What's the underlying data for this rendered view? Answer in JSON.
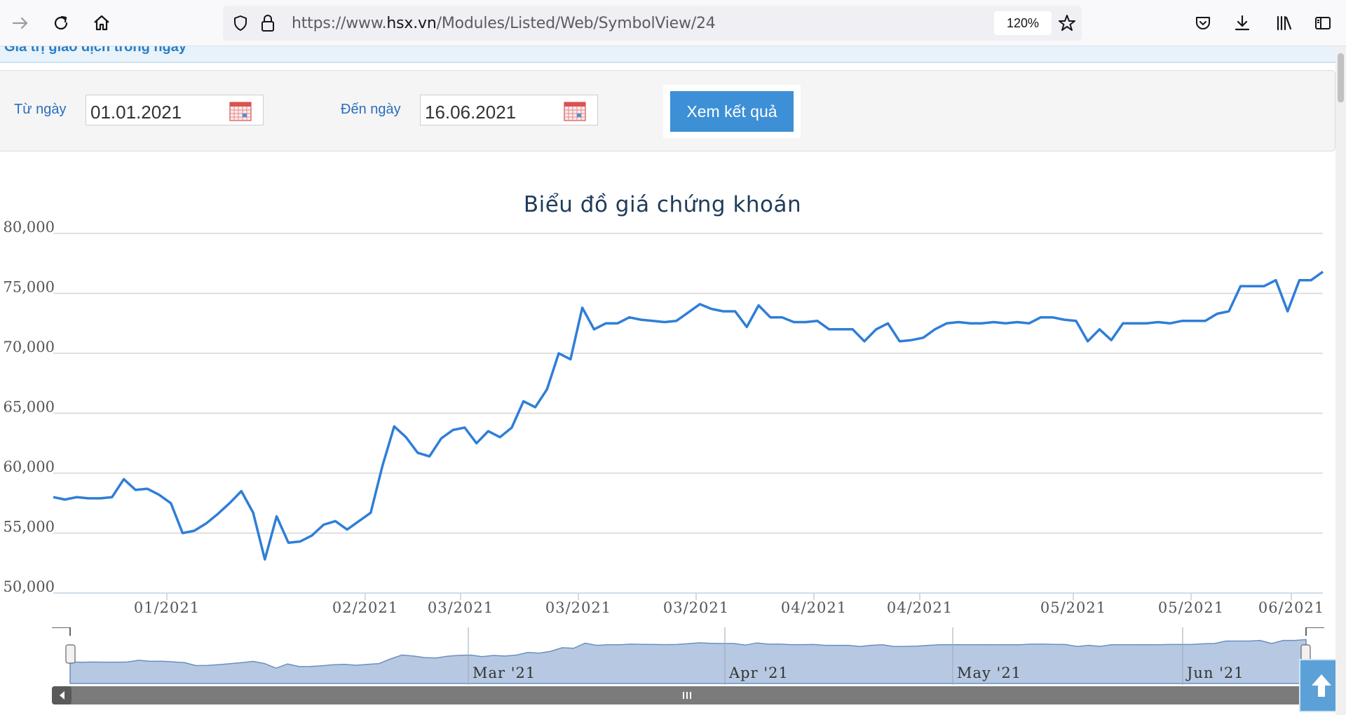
{
  "browser": {
    "url_prefix": "https://www.",
    "url_domain": "hsx.vn",
    "url_path": "/Modules/Listed/Web/SymbolView/24",
    "zoom": "120%"
  },
  "page": {
    "cut_heading": "Giá trị giao dịch trong ngày"
  },
  "filter": {
    "from_label": "Từ ngày",
    "from_value": "01.01.2021",
    "to_label": "Đến ngày",
    "to_value": "16.06.2021",
    "submit_label": "Xem kết quả"
  },
  "chart_data": {
    "type": "line",
    "title": "Biểu đồ giá chứng khoán",
    "ylim": [
      50000,
      80000
    ],
    "y_ticks": [
      "50,000",
      "55,000",
      "60,000",
      "65,000",
      "70,000",
      "75,000",
      "80,000"
    ],
    "x_tick_labels": [
      "01/2021",
      "02/2021",
      "03/2021",
      "03/2021",
      "03/2021",
      "04/2021",
      "04/2021",
      "05/2021",
      "05/2021",
      "06/2021"
    ],
    "grid": true,
    "color": "#2f7ed8",
    "series": [
      {
        "values": [
          58000,
          57800,
          58000,
          57900,
          57900,
          58000,
          59500,
          58600,
          58700,
          58200,
          57500,
          55000,
          55200,
          55800,
          56600,
          57500,
          58500,
          56700,
          52800,
          56400,
          54200,
          54300,
          54800,
          55700,
          56000,
          55300,
          56000,
          56700,
          60600,
          63900,
          63000,
          61700,
          61400,
          62900,
          63600,
          63800,
          62500,
          63500,
          63000,
          63800,
          66000,
          65500,
          67000,
          70000,
          69500,
          73800,
          72000,
          72500,
          72500,
          73000,
          72800,
          72700,
          72600,
          72700,
          73400,
          74100,
          73700,
          73500,
          73500,
          72200,
          74000,
          73000,
          73000,
          72600,
          72600,
          72700,
          72000,
          72000,
          72000,
          71000,
          72000,
          72500,
          71000,
          71100,
          71300,
          72000,
          72500,
          72600,
          72500,
          72500,
          72600,
          72500,
          72600,
          72500,
          73000,
          73000,
          72800,
          72700,
          71000,
          72000,
          71100,
          72500,
          72500,
          72500,
          72600,
          72500,
          72700,
          72700,
          72700,
          73300,
          73500,
          75600,
          75600,
          75600,
          76100,
          73500,
          76100,
          76100,
          76800
        ]
      }
    ]
  },
  "navigator": {
    "labels": [
      "Mar '21",
      "Apr '21",
      "May '21",
      "Jun '21"
    ]
  }
}
